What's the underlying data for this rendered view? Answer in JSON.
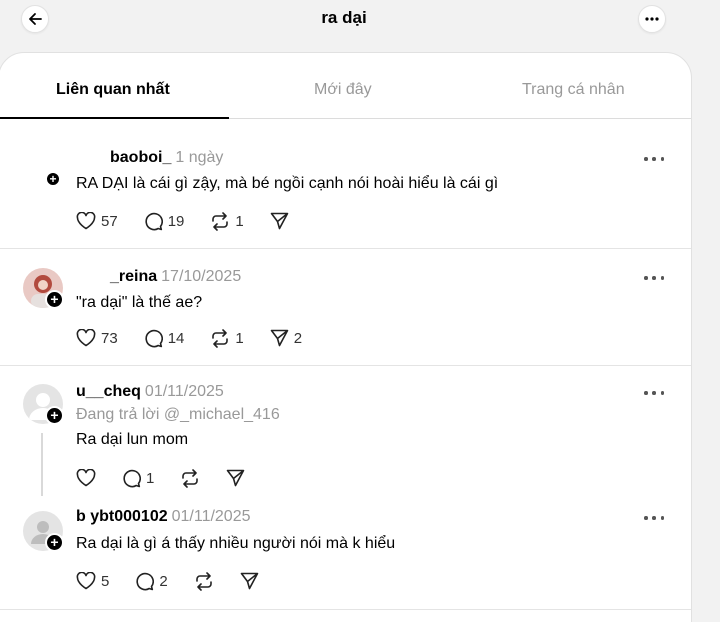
{
  "header": {
    "title": "ra dại"
  },
  "tabs": [
    {
      "label": "Liên quan nhất",
      "active": true
    },
    {
      "label": "Mới đây",
      "active": false
    },
    {
      "label": "Trang cá nhân",
      "active": false
    }
  ],
  "posts": [
    {
      "username": "baoboi_",
      "timestamp": "1 ngày",
      "text": "RA DẠI là cái gì zậy, mà bé ngồi cạnh nói hoài hiểu là cái gì",
      "likes": "57",
      "comments": "19",
      "reposts": "1",
      "shares": ""
    },
    {
      "username": "_reina",
      "timestamp": "17/10/2025",
      "text": "\"ra dại\" là thế ae?",
      "likes": "73",
      "comments": "14",
      "reposts": "1",
      "shares": "2"
    },
    {
      "username": "u__cheq",
      "timestamp": "01/11/2025",
      "reply_to": "Đang trả lời @_michael_416",
      "text": "Ra dại lun mom",
      "likes": "",
      "comments": "1",
      "reposts": "",
      "shares": ""
    },
    {
      "username": "b ybt000102",
      "timestamp": "01/11/2025",
      "text": "Ra dại là gì á thấy nhiều người nói mà k hiểu",
      "likes": "5",
      "comments": "2",
      "reposts": "",
      "shares": ""
    }
  ],
  "colors": {
    "muted": "#999999",
    "divider": "#e4e4e4",
    "background": "#f2f2f2"
  }
}
